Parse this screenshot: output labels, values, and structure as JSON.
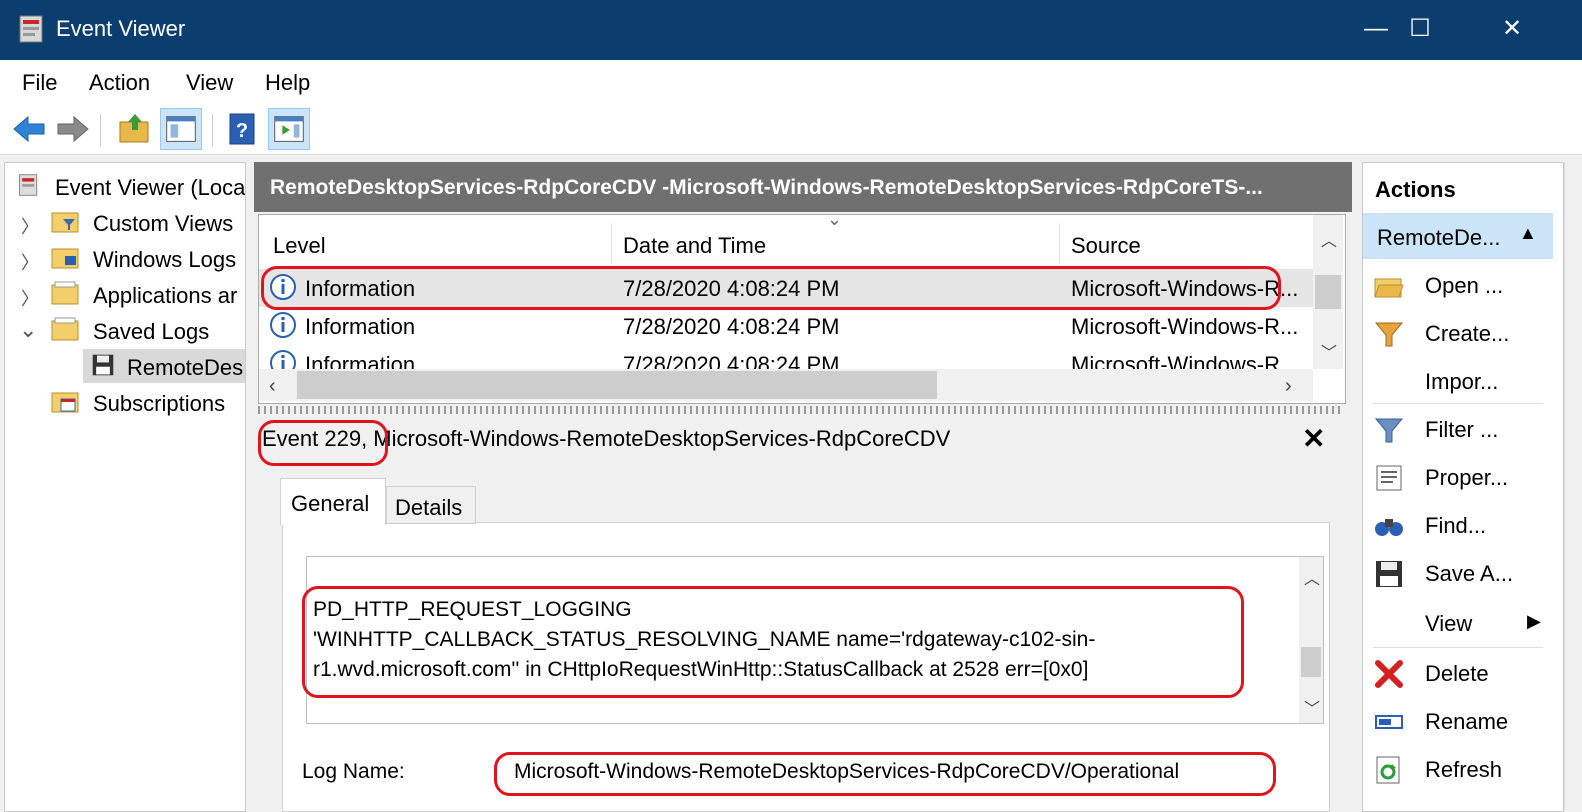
{
  "window": {
    "title": "Event Viewer",
    "controls": {
      "minimize": "—",
      "maximize": "☐",
      "close": "✕"
    }
  },
  "menu": [
    "File",
    "Action",
    "View",
    "Help"
  ],
  "tree": {
    "root": "Event Viewer (Loca",
    "items": [
      {
        "label": "Custom Views",
        "expanded": false
      },
      {
        "label": "Windows Logs",
        "expanded": false
      },
      {
        "label": "Applications ar",
        "expanded": false
      },
      {
        "label": "Saved Logs",
        "expanded": true
      },
      {
        "label": "RemoteDes",
        "selected": true
      },
      {
        "label": "Subscriptions"
      }
    ]
  },
  "center": {
    "header": "RemoteDesktopServices-RdpCoreCDV -Microsoft-Windows-RemoteDesktopServices-RdpCoreTS-...",
    "columns": [
      "Level",
      "Date and Time",
      "Source"
    ],
    "rows": [
      {
        "level": "Information",
        "datetime": "7/28/2020 4:08:24 PM",
        "source": "Microsoft-Windows-R..."
      },
      {
        "level": "Information",
        "datetime": "7/28/2020 4:08:24 PM",
        "source": "Microsoft-Windows-R..."
      },
      {
        "level": "Information",
        "datetime": "7/28/2020 4:08:24 PM",
        "source": "Microsoft-Windows-R..."
      }
    ],
    "event_title": "Event 229, Microsoft-Windows-RemoteDesktopServices-RdpCoreCDV",
    "tabs": [
      "General",
      "Details"
    ],
    "description": "PD_HTTP_REQUEST_LOGGING\n'WINHTTP_CALLBACK_STATUS_RESOLVING_NAME name='rdgateway-c102-sin-\nr1.wvd.microsoft.com'' in CHttpIoRequestWinHttp::StatusCallback at 2528 err=[0x0]",
    "log_name_label": "Log Name:",
    "log_name_value": "Microsoft-Windows-RemoteDesktopServices-RdpCoreCDV/Operational"
  },
  "actions": {
    "title": "Actions",
    "section": "RemoteDe...",
    "items": [
      "Open ...",
      "Create...",
      "Impor...",
      "Filter ...",
      "Proper...",
      "Find...",
      "Save A...",
      "View",
      "Delete",
      "Rename",
      "Refresh"
    ]
  },
  "colors": {
    "titlebar": "#0b3d6e",
    "highlight": "#e0141e",
    "selection": "#cce4f7"
  }
}
